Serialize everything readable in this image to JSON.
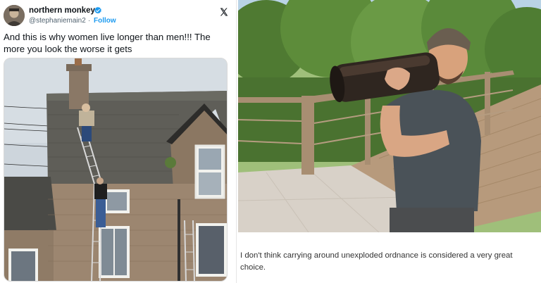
{
  "tweet": {
    "author_name": "northern monkey",
    "handle": "@stephaniemain2",
    "separator": "·",
    "follow_label": "Follow",
    "text": "And this is why women live longer than men!!! The more you look the worse it gets",
    "icons": {
      "avatar": "avatar",
      "verified": "verified-badge-icon",
      "platform": "x-logo-icon"
    },
    "colors": {
      "link": "#1d9bf0",
      "handle": "#536471",
      "name": "#0f1419"
    }
  },
  "caption": {
    "text": "I don't think carrying around unexploded ordnance is considered a very great choice."
  }
}
